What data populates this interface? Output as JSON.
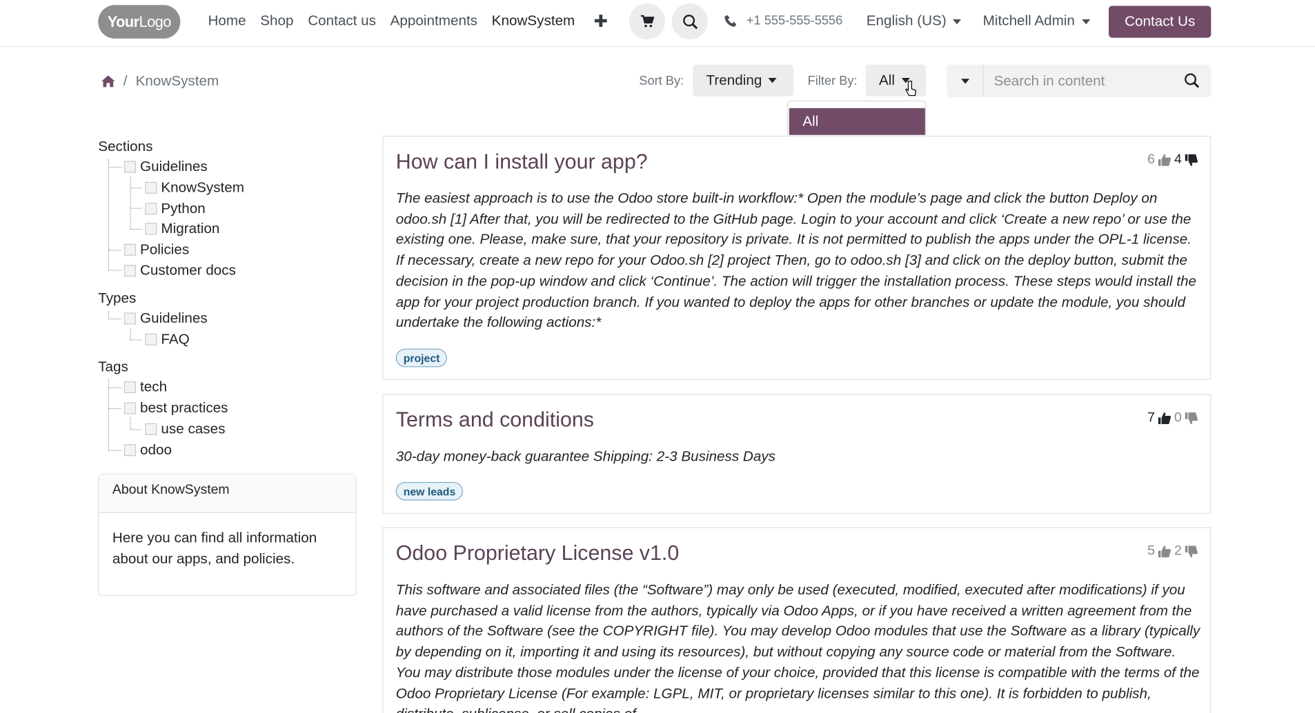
{
  "header": {
    "logo": {
      "bold": "Your",
      "thin": "Logo"
    },
    "nav": [
      "Home",
      "Shop",
      "Contact us",
      "Appointments",
      "KnowSystem"
    ],
    "phone": "+1 555-555-5556",
    "language": "English (US)",
    "user": "Mitchell Admin",
    "contact_button": "Contact Us"
  },
  "breadcrumb": {
    "current": "KnowSystem"
  },
  "toolbar": {
    "sort_label": "Sort By:",
    "sort_value": "Trending",
    "filter_label": "Filter By:",
    "filter_value": "All",
    "search_placeholder": "Search in content",
    "filter_options": [
      "All"
    ]
  },
  "sidebar": {
    "sections_title": "Sections",
    "sections": [
      "Guidelines",
      "KnowSystem",
      "Python",
      "Migration",
      "Policies",
      "Customer docs"
    ],
    "types_title": "Types",
    "types": [
      "Guidelines",
      "FAQ"
    ],
    "tags_title": "Tags",
    "tags": [
      "tech",
      "best practices",
      "use cases",
      "odoo"
    ],
    "about_title": "About KnowSystem",
    "about_text": "Here you can find all information about our apps, and policies."
  },
  "articles": [
    {
      "title": "How can I install your app?",
      "likes": "6",
      "dislikes": "4",
      "body": "The easiest approach is to use the Odoo store built-in workflow:* Open the module’s page and click the button Deploy on odoo.sh [1] After that, you will be redirected to the GitHub page. Login to your account and click ‘Create a new repo’ or use the existing one. Please, make sure, that your repository is private. It is not permitted to publish the apps under the OPL-1 license. If necessary, create a new repo for your Odoo.sh [2] project Then, go to odoo.sh [3] and click on the deploy button, submit the decision in the pop-up window and click ‘Continue’. The action will trigger the installation process. These steps would install the app for your project production branch. If you wanted to deploy the apps for other branches or update the module, you should undertake the following actions:*",
      "tag": "project"
    },
    {
      "title": "Terms and conditions",
      "likes": "7",
      "dislikes": "0",
      "body": "30-day money-back guarantee Shipping: 2-3 Business Days",
      "tag": "new leads"
    },
    {
      "title": "Odoo Proprietary License v1.0",
      "likes": "5",
      "dislikes": "2",
      "body": "This software and associated files (the “Software”) may only be used (executed, modified, executed after modifications) if you have purchased a valid license from the authors, typically via Odoo Apps, or if you have received a written agreement from the authors of the Software (see the COPYRIGHT file). You may develop Odoo modules that use the Software as a library (typically by depending on it, importing it and using its resources), but without copying any source code or material from the Software. You may distribute those modules under the license of your choice, provided that this license is compatible with the terms of the Odoo Proprietary License (For example: LGPL, MIT, or proprietary licenses similar to this one). It is forbidden to publish, distribute, sublicense, or sell copies of"
    }
  ],
  "colors": {
    "brand": "#714b67",
    "title": "#5a4256",
    "tag_border": "#7aa7c7"
  }
}
